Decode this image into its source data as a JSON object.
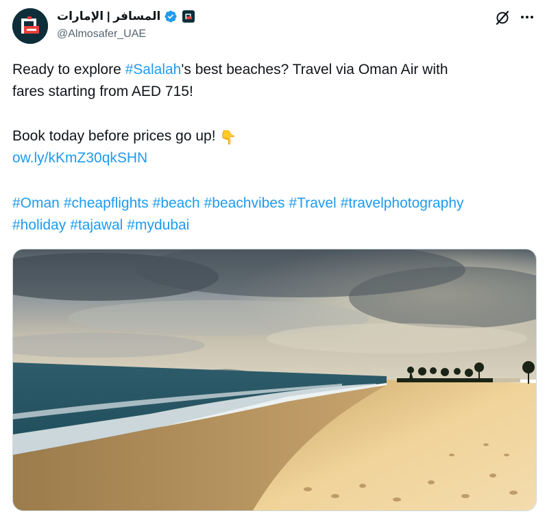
{
  "account": {
    "display_name": "المسافر | الإمارات",
    "handle": "@Almosafer_UAE",
    "verified": true,
    "brand_color": "#0e2f3a",
    "accent_color": "#e8403a"
  },
  "tweet": {
    "line1_before": "Ready to explore ",
    "line1_hashtag": "#Salalah",
    "line1_after": "'s best beaches? Travel via Oman Air with",
    "line2": "fares starting from AED 715!",
    "line3": "Book today before prices go up!",
    "line3_emoji": "👇",
    "link": "ow.ly/kKmZ30qkSHN",
    "hashtags_row1": [
      "#Oman",
      "#cheapflights",
      "#beach",
      "#beachvibes",
      "#Travel",
      "#travelphotography"
    ],
    "hashtags_row2": [
      "#holiday",
      "#tajawal",
      "#mydubai"
    ]
  },
  "media": {
    "description_icon": "beach-photo",
    "alt_name": "beach-photo"
  },
  "icons": {
    "grok": "grok-icon",
    "more": "more-icon",
    "verified": "verified-icon"
  },
  "colors": {
    "link": "#1d9bf0",
    "text": "#0f1419",
    "secondary": "#536471",
    "verified": "#1d9bf0"
  }
}
